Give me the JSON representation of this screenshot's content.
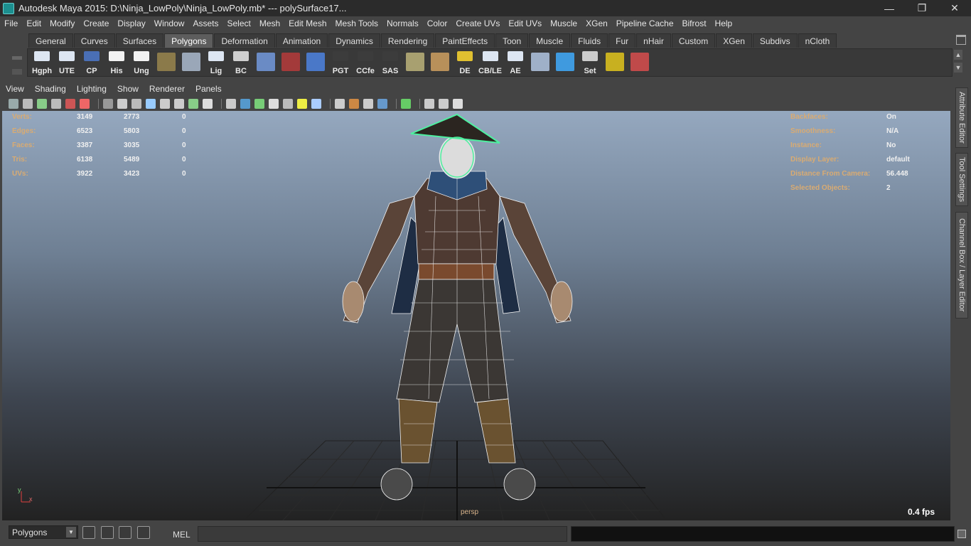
{
  "window": {
    "title": "Autodesk Maya 2015: D:\\Ninja_LowPoly\\Ninja_LowPoly.mb*  ---  polySurface17...",
    "minimize": "—",
    "maximize": "❐",
    "close": "✕"
  },
  "menus": [
    "File",
    "Edit",
    "Modify",
    "Create",
    "Display",
    "Window",
    "Assets",
    "Select",
    "Mesh",
    "Edit Mesh",
    "Mesh Tools",
    "Normals",
    "Color",
    "Create UVs",
    "Edit UVs",
    "Muscle",
    "XGen",
    "Pipeline Cache",
    "Bifrost",
    "Help"
  ],
  "shelf": {
    "tabs": [
      "General",
      "Curves",
      "Surfaces",
      "Polygons",
      "Deformation",
      "Animation",
      "Dynamics",
      "Rendering",
      "PaintEffects",
      "Toon",
      "Muscle",
      "Fluids",
      "Fur",
      "nHair",
      "Custom",
      "XGen",
      "Subdivs",
      "nCloth"
    ],
    "active_tab": "Polygons",
    "buttons": [
      {
        "label": "Hgph",
        "color": "#dde6f2"
      },
      {
        "label": "UTE",
        "color": "#dde6f2"
      },
      {
        "label": "CP",
        "color": "#4a6fb5"
      },
      {
        "label": "His",
        "color": "#f2f2f2"
      },
      {
        "label": "Ung",
        "color": "#f2f2f2"
      },
      {
        "label": "",
        "color": "#8b7a4a"
      },
      {
        "label": "",
        "color": "#9aa7b8"
      },
      {
        "label": "Lig",
        "color": "#dde6f2"
      },
      {
        "label": "BC",
        "color": "#cfcfcf"
      },
      {
        "label": "",
        "color": "#6a8bc5"
      },
      {
        "label": "",
        "color": "#a33a3a"
      },
      {
        "label": "",
        "color": "#4a78c8"
      },
      {
        "label": "PGT",
        "color": "#3c3c3c"
      },
      {
        "label": "CCfe",
        "color": "#3c3c3c"
      },
      {
        "label": "SAS",
        "color": "#3c3c3c"
      },
      {
        "label": "",
        "color": "#a8a070"
      },
      {
        "label": "",
        "color": "#b8905a"
      },
      {
        "label": "DE",
        "color": "#e0c030"
      },
      {
        "label": "CB/LE",
        "color": "#dde6f2"
      },
      {
        "label": "AE",
        "color": "#dde6f2"
      },
      {
        "label": "",
        "color": "#9fb0c8"
      },
      {
        "label": "",
        "color": "#3f9adf"
      },
      {
        "label": "Set",
        "color": "#cccccc"
      },
      {
        "label": "",
        "color": "#c8b020"
      },
      {
        "label": "",
        "color": "#c04a4a"
      }
    ]
  },
  "panel_menus": [
    "View",
    "Shading",
    "Lighting",
    "Show",
    "Renderer",
    "Panels"
  ],
  "hud_left": [
    {
      "label": "Verts:",
      "a": "3149",
      "b": "2773",
      "c": "0"
    },
    {
      "label": "Edges:",
      "a": "6523",
      "b": "5803",
      "c": "0"
    },
    {
      "label": "Faces:",
      "a": "3387",
      "b": "3035",
      "c": "0"
    },
    {
      "label": "Tris:",
      "a": "6138",
      "b": "5489",
      "c": "0"
    },
    {
      "label": "UVs:",
      "a": "3922",
      "b": "3423",
      "c": "0"
    }
  ],
  "hud_right": [
    {
      "label": "Backfaces:",
      "value": "On"
    },
    {
      "label": "Smoothness:",
      "value": "N/A"
    },
    {
      "label": "Instance:",
      "value": "No"
    },
    {
      "label": "Display Layer:",
      "value": "default"
    },
    {
      "label": "Distance From Camera:",
      "value": "56.448"
    },
    {
      "label": "Selected Objects:",
      "value": "2"
    }
  ],
  "viewport": {
    "camera": "persp",
    "fps": "0.4 fps",
    "axis_y": "y",
    "axis_x": "x"
  },
  "side_tabs": [
    "Attribute Editor",
    "Tool Settings",
    "Channel Box / Layer Editor"
  ],
  "command_line": {
    "mode": "Polygons",
    "lang": "MEL"
  }
}
